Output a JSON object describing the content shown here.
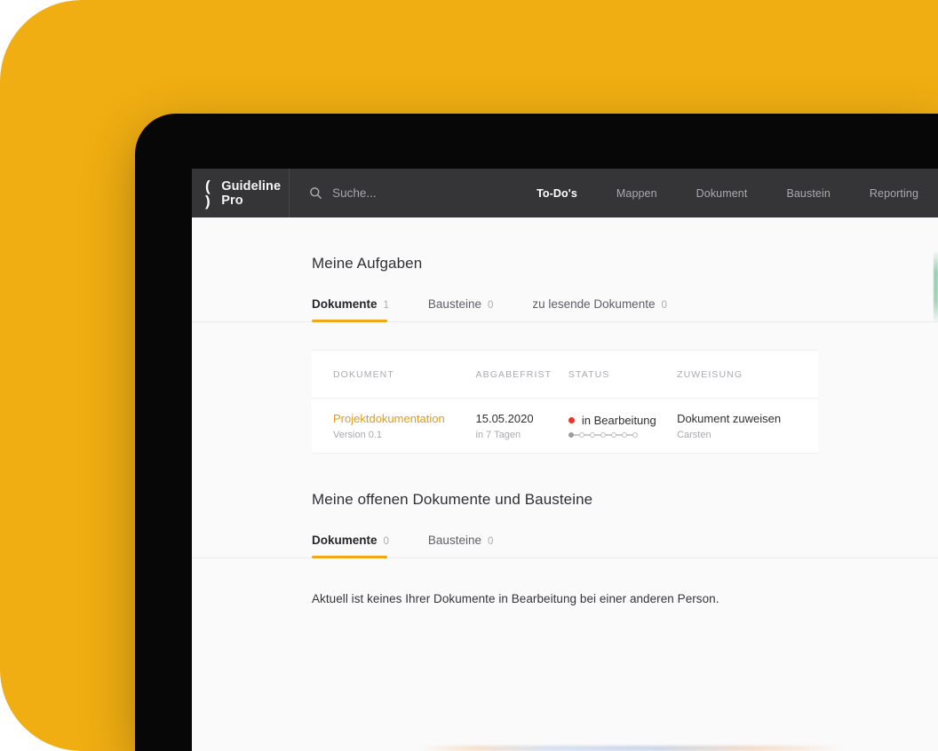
{
  "brand": {
    "mark": "( )",
    "name": "Guideline Pro"
  },
  "search": {
    "icon": "search-icon",
    "placeholder": "Suche...",
    "value": ""
  },
  "nav": {
    "items": [
      {
        "label": "To-Do's",
        "active": true
      },
      {
        "label": "Mappen",
        "active": false
      },
      {
        "label": "Dokument",
        "active": false
      },
      {
        "label": "Baustein",
        "active": false
      },
      {
        "label": "Reporting",
        "active": false
      }
    ]
  },
  "sections": {
    "tasks": {
      "title": "Meine Aufgaben",
      "tabs": [
        {
          "label": "Dokumente",
          "count": "1",
          "active": true
        },
        {
          "label": "Bausteine",
          "count": "0",
          "active": false
        },
        {
          "label": "zu lesende Dokumente",
          "count": "0",
          "active": false
        }
      ],
      "table": {
        "headers": [
          "DOKUMENT",
          "ABGABEFRIST",
          "STATUS",
          "ZUWEISUNG"
        ],
        "rows": [
          {
            "document": "Projektdokumentation",
            "document_sub": "Version 0.1",
            "deadline": "15.05.2020",
            "deadline_sub": "in 7 Tagen",
            "status": "in Bearbeitung",
            "status_color": "#E8342A",
            "steps_total": 7,
            "steps_done": 1,
            "assignment": "Dokument zuweisen",
            "assignment_sub": "Carsten"
          }
        ]
      }
    },
    "open": {
      "title": "Meine offenen Dokumente und Bausteine",
      "tabs": [
        {
          "label": "Dokumente",
          "count": "0",
          "active": true
        },
        {
          "label": "Bausteine",
          "count": "0",
          "active": false
        }
      ],
      "empty_text": "Aktuell ist keines Ihrer Dokumente in Bearbeitung bei einer anderen Person."
    }
  },
  "colors": {
    "backdrop_orange": "#F0AE12",
    "accent_orange": "#F0A81A",
    "topbar_dark": "#353538",
    "link_orange": "#E39B12",
    "status_red": "#E8342A",
    "device_black": "#070707"
  }
}
